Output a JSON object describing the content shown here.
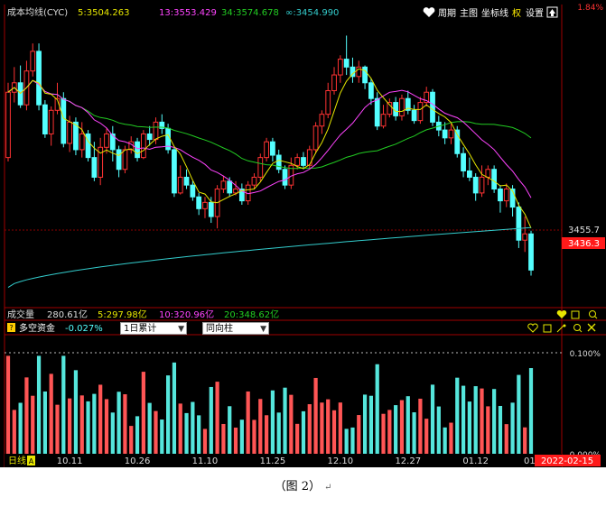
{
  "header": {
    "title": "成本均线(CYC)",
    "ma5": "5:3504.263",
    "ma13": "13:3553.429",
    "ma34": "34:3574.678",
    "ma_inf": "∞:3454.990",
    "menu": [
      "周期",
      "主图",
      "坐标线",
      "权",
      "设置"
    ],
    "top_pct": "1.84%"
  },
  "price_axis": {
    "mid_label": "3455.7",
    "last_label": "3436.3"
  },
  "volume_bar": {
    "label": "成交量",
    "vol": "280.61亿",
    "v5": "5:297.98亿",
    "v10": "10:320.96亿",
    "v20": "20:348.62亿"
  },
  "indicator_bar": {
    "name": "多空资金",
    "value": "-0.027%",
    "select1": "1日累计",
    "select2": "同向柱",
    "pct_top": "0.100%",
    "pct_bottom": "0.000%"
  },
  "time_axis": {
    "period": "日线",
    "dates": [
      "10.11",
      "10.26",
      "11.10",
      "11.25",
      "12.10",
      "12.27",
      "01.12",
      "01."
    ],
    "cursor_date": "2022-02-15"
  },
  "caption": "（图 2）",
  "colors": {
    "up": "#ff3333",
    "down": "#54ffff",
    "ma5": "#e6e600",
    "ma13": "#ff44ff",
    "ma34": "#22cc22",
    "ma_inf": "#33cccc",
    "bar_up": "#ff5555",
    "bar_down": "#55e6dc"
  },
  "chart_data": {
    "type": "candlestick",
    "title": "成本均线(CYC)",
    "ylim": [
      3360,
      3720
    ],
    "candles": [
      {
        "o": 3545,
        "c": 3628,
        "h": 3640,
        "l": 3540
      },
      {
        "o": 3628,
        "c": 3640,
        "h": 3660,
        "l": 3615
      },
      {
        "o": 3640,
        "c": 3612,
        "h": 3662,
        "l": 3608
      },
      {
        "o": 3612,
        "c": 3655,
        "h": 3668,
        "l": 3605
      },
      {
        "o": 3655,
        "c": 3680,
        "h": 3690,
        "l": 3648
      },
      {
        "o": 3680,
        "c": 3612,
        "h": 3690,
        "l": 3605
      },
      {
        "o": 3612,
        "c": 3575,
        "h": 3618,
        "l": 3570
      },
      {
        "o": 3575,
        "c": 3605,
        "h": 3610,
        "l": 3560
      },
      {
        "o": 3605,
        "c": 3620,
        "h": 3640,
        "l": 3600
      },
      {
        "o": 3620,
        "c": 3563,
        "h": 3628,
        "l": 3558
      },
      {
        "o": 3563,
        "c": 3590,
        "h": 3598,
        "l": 3552
      },
      {
        "o": 3590,
        "c": 3555,
        "h": 3596,
        "l": 3548
      },
      {
        "o": 3555,
        "c": 3575,
        "h": 3590,
        "l": 3545
      },
      {
        "o": 3575,
        "c": 3545,
        "h": 3580,
        "l": 3540
      },
      {
        "o": 3545,
        "c": 3520,
        "h": 3565,
        "l": 3515
      },
      {
        "o": 3520,
        "c": 3558,
        "h": 3570,
        "l": 3510
      },
      {
        "o": 3558,
        "c": 3575,
        "h": 3582,
        "l": 3550
      },
      {
        "o": 3575,
        "c": 3555,
        "h": 3585,
        "l": 3540
      },
      {
        "o": 3555,
        "c": 3530,
        "h": 3560,
        "l": 3520
      },
      {
        "o": 3530,
        "c": 3555,
        "h": 3560,
        "l": 3525
      },
      {
        "o": 3555,
        "c": 3565,
        "h": 3572,
        "l": 3550
      },
      {
        "o": 3565,
        "c": 3545,
        "h": 3570,
        "l": 3540
      },
      {
        "o": 3545,
        "c": 3575,
        "h": 3580,
        "l": 3543
      },
      {
        "o": 3575,
        "c": 3568,
        "h": 3585,
        "l": 3560
      },
      {
        "o": 3568,
        "c": 3590,
        "h": 3596,
        "l": 3562
      },
      {
        "o": 3590,
        "c": 3582,
        "h": 3600,
        "l": 3575
      },
      {
        "o": 3582,
        "c": 3555,
        "h": 3588,
        "l": 3550
      },
      {
        "o": 3555,
        "c": 3500,
        "h": 3558,
        "l": 3495
      },
      {
        "o": 3500,
        "c": 3520,
        "h": 3535,
        "l": 3498
      },
      {
        "o": 3520,
        "c": 3510,
        "h": 3530,
        "l": 3505
      },
      {
        "o": 3510,
        "c": 3495,
        "h": 3515,
        "l": 3490
      },
      {
        "o": 3495,
        "c": 3480,
        "h": 3500,
        "l": 3472
      },
      {
        "o": 3480,
        "c": 3488,
        "h": 3495,
        "l": 3468
      },
      {
        "o": 3488,
        "c": 3470,
        "h": 3495,
        "l": 3462
      },
      {
        "o": 3470,
        "c": 3505,
        "h": 3510,
        "l": 3455
      },
      {
        "o": 3505,
        "c": 3515,
        "h": 3522,
        "l": 3500
      },
      {
        "o": 3515,
        "c": 3500,
        "h": 3520,
        "l": 3495
      },
      {
        "o": 3500,
        "c": 3505,
        "h": 3515,
        "l": 3497
      },
      {
        "o": 3505,
        "c": 3490,
        "h": 3512,
        "l": 3485
      },
      {
        "o": 3490,
        "c": 3510,
        "h": 3515,
        "l": 3485
      },
      {
        "o": 3510,
        "c": 3520,
        "h": 3525,
        "l": 3505
      },
      {
        "o": 3520,
        "c": 3545,
        "h": 3550,
        "l": 3515
      },
      {
        "o": 3545,
        "c": 3565,
        "h": 3570,
        "l": 3540
      },
      {
        "o": 3565,
        "c": 3548,
        "h": 3570,
        "l": 3540
      },
      {
        "o": 3548,
        "c": 3530,
        "h": 3555,
        "l": 3525
      },
      {
        "o": 3530,
        "c": 3510,
        "h": 3535,
        "l": 3505
      },
      {
        "o": 3510,
        "c": 3535,
        "h": 3545,
        "l": 3505
      },
      {
        "o": 3535,
        "c": 3545,
        "h": 3550,
        "l": 3530
      },
      {
        "o": 3545,
        "c": 3535,
        "h": 3552,
        "l": 3530
      },
      {
        "o": 3535,
        "c": 3555,
        "h": 3560,
        "l": 3530
      },
      {
        "o": 3555,
        "c": 3585,
        "h": 3590,
        "l": 3550
      },
      {
        "o": 3585,
        "c": 3600,
        "h": 3605,
        "l": 3575
      },
      {
        "o": 3600,
        "c": 3630,
        "h": 3640,
        "l": 3595
      },
      {
        "o": 3630,
        "c": 3650,
        "h": 3660,
        "l": 3625
      },
      {
        "o": 3650,
        "c": 3670,
        "h": 3675,
        "l": 3640
      },
      {
        "o": 3670,
        "c": 3660,
        "h": 3700,
        "l": 3650
      },
      {
        "o": 3660,
        "c": 3648,
        "h": 3672,
        "l": 3640
      },
      {
        "o": 3648,
        "c": 3660,
        "h": 3668,
        "l": 3640
      },
      {
        "o": 3660,
        "c": 3640,
        "h": 3662,
        "l": 3632
      },
      {
        "o": 3640,
        "c": 3620,
        "h": 3645,
        "l": 3612
      },
      {
        "o": 3620,
        "c": 3585,
        "h": 3628,
        "l": 3580
      },
      {
        "o": 3585,
        "c": 3600,
        "h": 3612,
        "l": 3582
      },
      {
        "o": 3600,
        "c": 3615,
        "h": 3620,
        "l": 3596
      },
      {
        "o": 3615,
        "c": 3598,
        "h": 3622,
        "l": 3592
      },
      {
        "o": 3598,
        "c": 3620,
        "h": 3625,
        "l": 3592
      },
      {
        "o": 3620,
        "c": 3605,
        "h": 3630,
        "l": 3600
      },
      {
        "o": 3605,
        "c": 3592,
        "h": 3612,
        "l": 3588
      },
      {
        "o": 3592,
        "c": 3615,
        "h": 3622,
        "l": 3588
      },
      {
        "o": 3615,
        "c": 3628,
        "h": 3635,
        "l": 3610
      },
      {
        "o": 3628,
        "c": 3590,
        "h": 3632,
        "l": 3585
      },
      {
        "o": 3590,
        "c": 3580,
        "h": 3598,
        "l": 3572
      },
      {
        "o": 3580,
        "c": 3570,
        "h": 3590,
        "l": 3562
      },
      {
        "o": 3570,
        "c": 3580,
        "h": 3588,
        "l": 3562
      },
      {
        "o": 3580,
        "c": 3550,
        "h": 3585,
        "l": 3545
      },
      {
        "o": 3550,
        "c": 3528,
        "h": 3558,
        "l": 3520
      },
      {
        "o": 3528,
        "c": 3520,
        "h": 3545,
        "l": 3515
      },
      {
        "o": 3520,
        "c": 3500,
        "h": 3525,
        "l": 3490
      },
      {
        "o": 3500,
        "c": 3520,
        "h": 3535,
        "l": 3495
      },
      {
        "o": 3520,
        "c": 3530,
        "h": 3535,
        "l": 3510
      },
      {
        "o": 3530,
        "c": 3505,
        "h": 3535,
        "l": 3500
      },
      {
        "o": 3505,
        "c": 3490,
        "h": 3510,
        "l": 3475
      },
      {
        "o": 3490,
        "c": 3505,
        "h": 3512,
        "l": 3482
      },
      {
        "o": 3505,
        "c": 3482,
        "h": 3510,
        "l": 3470
      },
      {
        "o": 3482,
        "c": 3440,
        "h": 3488,
        "l": 3430
      },
      {
        "o": 3440,
        "c": 3448,
        "h": 3470,
        "l": 3425
      },
      {
        "o": 3448,
        "c": 3402,
        "h": 3452,
        "l": 3395
      }
    ],
    "ma_inf_range": [
      3380,
      3456
    ]
  }
}
